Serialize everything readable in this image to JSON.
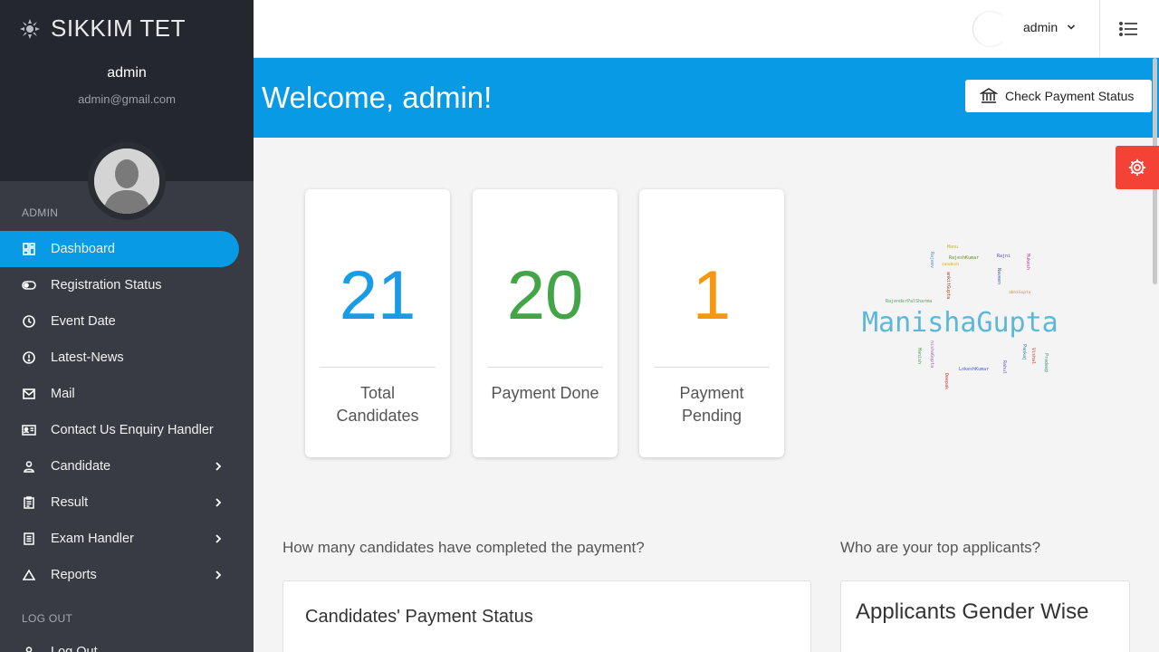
{
  "app": {
    "brand": "SIKKIM TET",
    "user_name": "admin",
    "user_email": "admin@gmail.com"
  },
  "sidebar": {
    "section_admin": "ADMIN",
    "section_logout": "LOG OUT",
    "items": [
      {
        "label": "Dashboard",
        "icon": "dashboard-icon",
        "active": true
      },
      {
        "label": "Registration Status",
        "icon": "toggle-icon"
      },
      {
        "label": "Event Date",
        "icon": "clock-icon"
      },
      {
        "label": "Latest-News",
        "icon": "news-icon"
      },
      {
        "label": "Mail",
        "icon": "mail-icon"
      },
      {
        "label": "Contact Us Enquiry Handler",
        "icon": "contact-card-icon"
      },
      {
        "label": "Candidate",
        "icon": "person-icon",
        "has_submenu": true
      },
      {
        "label": "Result",
        "icon": "clipboard-icon",
        "has_submenu": true
      },
      {
        "label": "Exam Handler",
        "icon": "list-icon",
        "has_submenu": true
      },
      {
        "label": "Reports",
        "icon": "triangle-icon",
        "has_submenu": true
      }
    ],
    "logout_label": "Log Out"
  },
  "topbar": {
    "user_label": "admin"
  },
  "banner": {
    "welcome": "Welcome, admin!",
    "button_label": "Check Payment Status"
  },
  "stats": [
    {
      "value": "21",
      "label": "Total Candidates",
      "color": "#1a9be6"
    },
    {
      "value": "20",
      "label": "Payment Done",
      "color": "#43a547"
    },
    {
      "value": "1",
      "label": "Payment Pending",
      "color": "#f7960f"
    }
  ],
  "wordcloud": {
    "main": "ManishaGupta",
    "words": [
      "Manu",
      "Rajeev",
      "Rajni",
      "RajeshKumar",
      "sandesh",
      "Mukesh",
      "Naveen",
      "ankitGupta",
      "RajenderPalSharma",
      "nishaGupta",
      "LokeshKumar",
      "abhiGupta",
      "Manish",
      "Deepak",
      "Pankaj",
      "Vishal",
      "Pradeep",
      "Rahul"
    ]
  },
  "sections": {
    "payment_question": "How many candidates have completed the payment?",
    "payment_panel_title": "Candidates' Payment Status",
    "applicants_question": "Who are your top applicants?",
    "applicants_panel_title": "Applicants Gender Wise"
  }
}
